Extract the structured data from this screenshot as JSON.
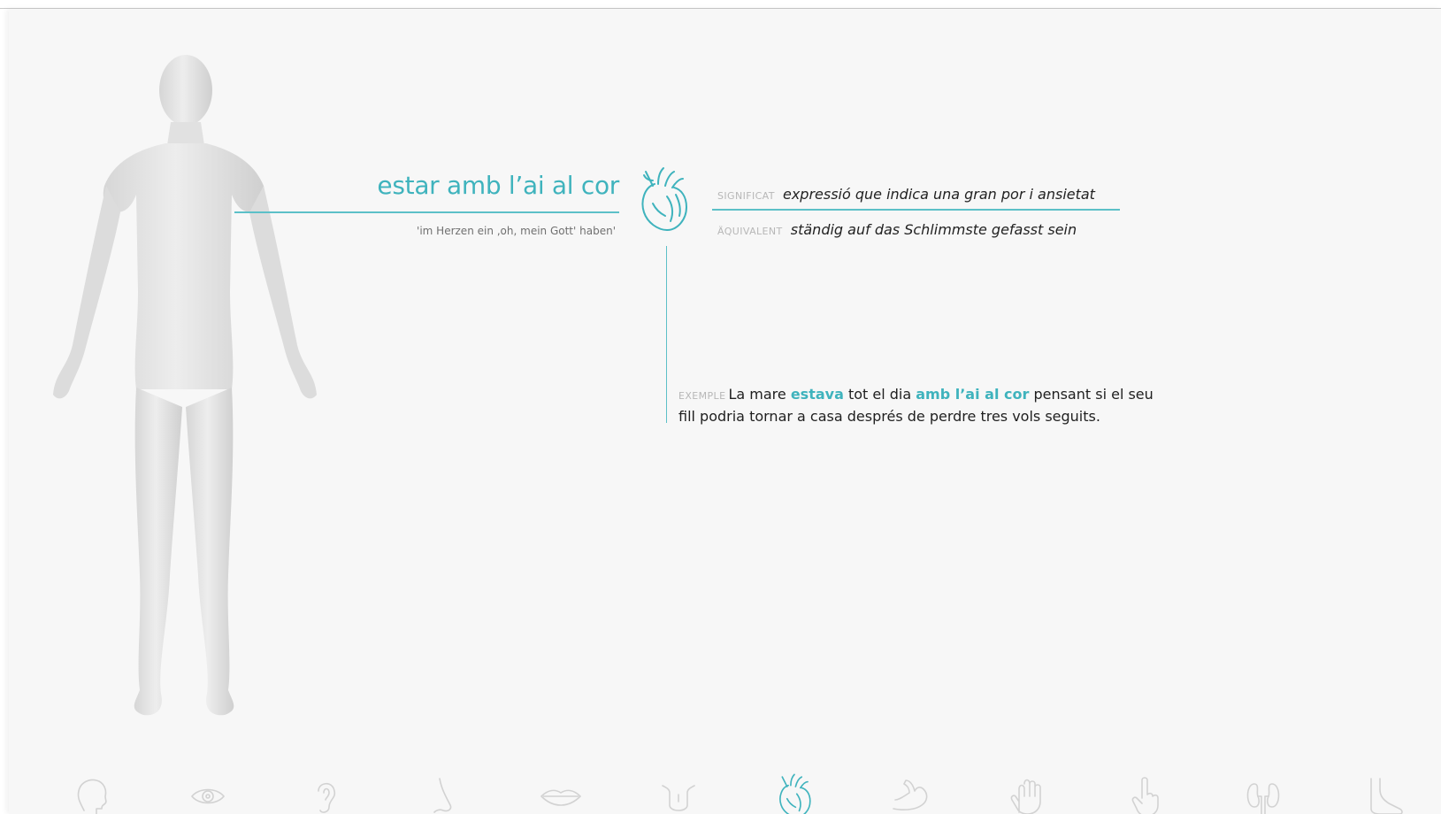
{
  "idiom": {
    "title": "estar amb l’ai al cor",
    "translation": "'im Herzen ein ‚oh, mein Gott' haben'"
  },
  "definition": {
    "significat_label": "SIGNIFICAT",
    "significat_text": "expressió que indica una gran por i ansietat",
    "aquivalent_label": "ÄQUIVALENT",
    "aquivalent_text": "ständig auf das Schlimmste gefasst sein"
  },
  "example": {
    "label": "EXEMPLE",
    "part1": "La mare ",
    "hl1": "estava",
    "part2": " tot el dia ",
    "hl2": "amb l’ai al cor",
    "part3": " pensant si el seu fill podria tornar a casa després de perdre tres vols seguits."
  },
  "nav": {
    "items": [
      {
        "name": "head",
        "icon": "head-icon",
        "active": false
      },
      {
        "name": "eye",
        "icon": "eye-icon",
        "active": false
      },
      {
        "name": "ear",
        "icon": "ear-icon",
        "active": false
      },
      {
        "name": "nose",
        "icon": "nose-icon",
        "active": false
      },
      {
        "name": "lips",
        "icon": "lips-icon",
        "active": false
      },
      {
        "name": "tongue",
        "icon": "tongue-icon",
        "active": false
      },
      {
        "name": "heart",
        "icon": "heart-icon",
        "active": true
      },
      {
        "name": "arm",
        "icon": "arm-icon",
        "active": false
      },
      {
        "name": "hand",
        "icon": "hand-icon",
        "active": false
      },
      {
        "name": "finger",
        "icon": "finger-icon",
        "active": false
      },
      {
        "name": "kidneys",
        "icon": "kidneys-icon",
        "active": false
      },
      {
        "name": "foot",
        "icon": "foot-icon",
        "active": false
      }
    ]
  },
  "colors": {
    "accent": "#3fb3bd",
    "inactive_icon": "#d2d2d2",
    "background": "#f7f7f7"
  }
}
